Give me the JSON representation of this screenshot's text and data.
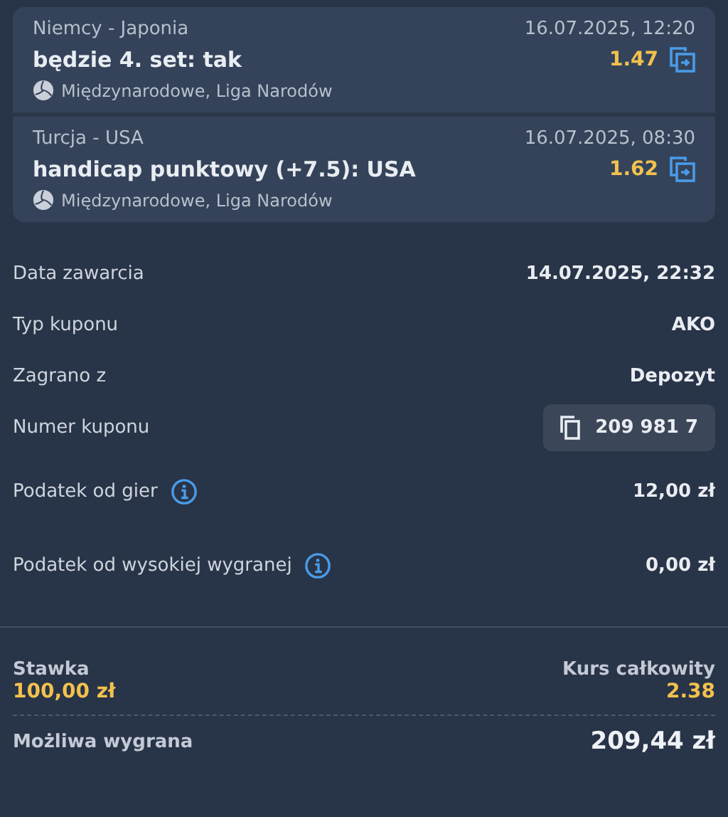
{
  "events": [
    {
      "teams": "Niemcy - Japonia",
      "datetime": "16.07.2025, 12:20",
      "selection": "będzie 4. set: tak",
      "odds": "1.47",
      "league": "Międzynarodowe, Liga Narodów"
    },
    {
      "teams": "Turcja - USA",
      "datetime": "16.07.2025, 08:30",
      "selection": "handicap punktowy (+7.5): USA",
      "odds": "1.62",
      "league": "Międzynarodowe, Liga Narodów"
    }
  ],
  "details": [
    {
      "kind": "plain",
      "label": "Data zawarcia",
      "value": "14.07.2025, 22:32"
    },
    {
      "kind": "plain",
      "label": "Typ kuponu",
      "value": "AKO"
    },
    {
      "kind": "plain",
      "label": "Zagrano z",
      "value": "Depozyt"
    },
    {
      "kind": "copy",
      "label": "Numer kuponu",
      "value": "209 981 7"
    },
    {
      "kind": "info",
      "label": "Podatek od gier",
      "value": "12,00 zł"
    },
    {
      "kind": "info",
      "label": "Podatek od wysokiej wygranej",
      "value": "0,00 zł"
    }
  ],
  "summary": {
    "stake_label": "Stawka",
    "stake": "100,00 zł",
    "odds_label": "Kurs całkowity",
    "odds": "2.38",
    "win_label": "Możliwa wygrana",
    "win": "209,44 zł"
  }
}
